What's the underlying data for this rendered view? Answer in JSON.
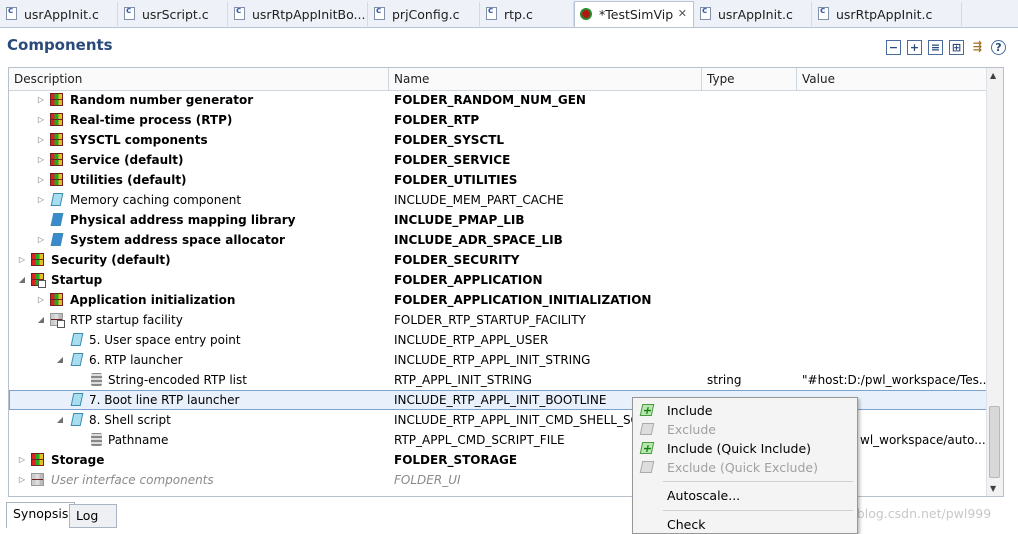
{
  "tabs": [
    {
      "label": "usrAppInit.c"
    },
    {
      "label": "usrScript.c"
    },
    {
      "label": "usrRtpAppInitBo..."
    },
    {
      "label": "prjConfig.c"
    },
    {
      "label": "rtp.c"
    },
    {
      "label": "*TestSimVip"
    },
    {
      "label": "usrAppInit.c"
    },
    {
      "label": "usrRtpAppInit.c"
    }
  ],
  "header": {
    "title": "Components"
  },
  "toolbar": [
    "collapse-icon",
    "expand-icon",
    "collapse-all-icon",
    "expand-all-icon",
    "filter-icon",
    "help-icon"
  ],
  "columns": {
    "desc": "Description",
    "name": "Name",
    "type": "Type",
    "value": "Value"
  },
  "rows": [
    {
      "desc": "Random number generator",
      "name": "FOLDER_RANDOM_NUM_GEN",
      "type": "",
      "value": ""
    },
    {
      "desc": "Real-time process (RTP)",
      "name": "FOLDER_RTP",
      "type": "",
      "value": ""
    },
    {
      "desc": "SYSCTL components",
      "name": "FOLDER_SYSCTL",
      "type": "",
      "value": ""
    },
    {
      "desc": "Service (default)",
      "name": "FOLDER_SERVICE",
      "type": "",
      "value": ""
    },
    {
      "desc": "Utilities (default)",
      "name": "FOLDER_UTILITIES",
      "type": "",
      "value": ""
    },
    {
      "desc": "Memory caching component",
      "name": "INCLUDE_MEM_PART_CACHE",
      "type": "",
      "value": ""
    },
    {
      "desc": "Physical address mapping library",
      "name": "INCLUDE_PMAP_LIB",
      "type": "",
      "value": ""
    },
    {
      "desc": "System address space allocator",
      "name": "INCLUDE_ADR_SPACE_LIB",
      "type": "",
      "value": ""
    },
    {
      "desc": "Security (default)",
      "name": "FOLDER_SECURITY",
      "type": "",
      "value": ""
    },
    {
      "desc": "Startup",
      "name": "FOLDER_APPLICATION",
      "type": "",
      "value": ""
    },
    {
      "desc": "Application initialization",
      "name": "FOLDER_APPLICATION_INITIALIZATION",
      "type": "",
      "value": ""
    },
    {
      "desc": "RTP startup facility",
      "name": "FOLDER_RTP_STARTUP_FACILITY",
      "type": "",
      "value": ""
    },
    {
      "desc": "5. User space entry point",
      "name": "INCLUDE_RTP_APPL_USER",
      "type": "",
      "value": ""
    },
    {
      "desc": "6. RTP launcher",
      "name": "INCLUDE_RTP_APPL_INIT_STRING",
      "type": "",
      "value": ""
    },
    {
      "desc": "String-encoded RTP list",
      "name": "RTP_APPL_INIT_STRING",
      "type": "string",
      "value": "\"#host:D:/pwl_workspace/Tes..."
    },
    {
      "desc": "7. Boot line RTP launcher",
      "name": "INCLUDE_RTP_APPL_INIT_BOOTLINE",
      "type": "",
      "value": ""
    },
    {
      "desc": "8. Shell script",
      "name": "INCLUDE_RTP_APPL_INIT_CMD_SHELL_SC",
      "type": "",
      "value": ""
    },
    {
      "desc": "Pathname",
      "name": "RTP_APPL_CMD_SCRIPT_FILE",
      "type": "",
      "value": "wl_workspace/auto..."
    },
    {
      "desc": "Storage",
      "name": "FOLDER_STORAGE",
      "type": "",
      "value": ""
    },
    {
      "desc": "User interface components",
      "name": "FOLDER_UI",
      "type": "",
      "value": ""
    }
  ],
  "context_menu": [
    {
      "label": "Include",
      "enabled": true
    },
    {
      "label": "Exclude",
      "enabled": false
    },
    {
      "label": "Include (Quick Include)",
      "enabled": true
    },
    {
      "label": "Exclude (Quick Exclude)",
      "enabled": false
    },
    {
      "label": "Autoscale...",
      "enabled": true
    },
    {
      "label": "Check",
      "enabled": true
    }
  ],
  "bottom_tabs": [
    {
      "label": "Synopsis"
    },
    {
      "label": "Log"
    }
  ],
  "watermark": "https://blog.csdn.net/pwl999"
}
